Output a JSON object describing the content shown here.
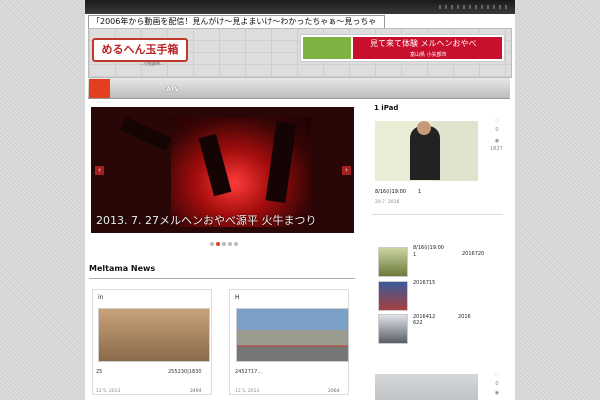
{
  "tagline": "「2006年から動画を配信！見んがけ〜見よまいけ〜わかったちゃぁ〜見っちゃぁ！」",
  "logo": {
    "text": "めるへん玉手箱",
    "sub": "…小矢部市…"
  },
  "banner": {
    "title": "見て来て体験 メルヘンおやべ",
    "city": "富山県 小矢部市"
  },
  "nav": {
    "item_catv": "CATV"
  },
  "slider": {
    "caption": "2013. 7. 27メルヘンおやべ源平 火牛まつり",
    "prev": "‹",
    "next": "›",
    "dots": 5,
    "active_dot": 2
  },
  "news": {
    "title": "Meltama News",
    "cards": [
      {
        "label": "in",
        "text_left": "25",
        "text_right": "255230|1830",
        "date": "12 5, 2013",
        "views": "2494"
      },
      {
        "label": "H",
        "text_left": "2452717...",
        "text_right": "",
        "date": "12 5, 2013",
        "views": "2064"
      }
    ]
  },
  "featured": {
    "title": "1  iPad",
    "caption_time": "8/16(i)19:00",
    "caption_num": "1",
    "date": "20.7. 2016",
    "likes": "0",
    "views": "1827"
  },
  "mini_list": [
    {
      "title": "8/16(i)19:00",
      "sub": "1",
      "right": "2016720"
    },
    {
      "title": "2016715",
      "sub": "",
      "right": ""
    },
    {
      "title": "2016412",
      "sub": "622",
      "right": "2016"
    }
  ],
  "bottom": {
    "likes": "0",
    "views": "0"
  }
}
